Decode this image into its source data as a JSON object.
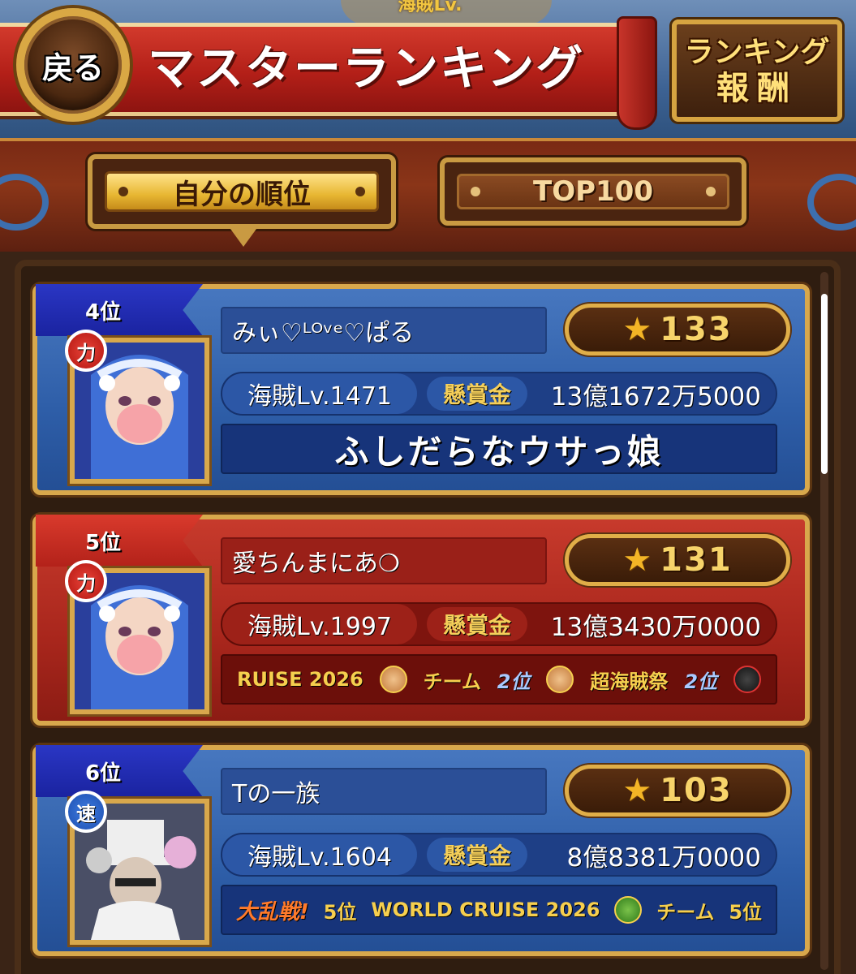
{
  "header": {
    "top_hint": "海賊Lv.",
    "back_label": "戻る",
    "title": "マスターランキング",
    "reward_line1": "ランキング",
    "reward_line2": "報酬"
  },
  "tabs": [
    {
      "label": "自分の順位",
      "active": true
    },
    {
      "label": "TOP100",
      "active": false
    }
  ],
  "rankings": [
    {
      "rank": "4位",
      "theme": "blue",
      "attribute": "力",
      "name": "みぃ♡ᴸᴼᵛᵉ♡ぱる",
      "stars": "133",
      "pirate_lv": "海賊Lv.1471",
      "bounty_label": "懸賞金",
      "bounty": "13億1672万5000",
      "title": "ふしだらなウサっ娘"
    },
    {
      "rank": "5位",
      "theme": "red",
      "attribute": "力",
      "name": "愛ちんまにあ❍",
      "stars": "131",
      "pirate_lv": "海賊Lv.1997",
      "bounty_label": "懸賞金",
      "bounty": "13億3430万0000",
      "badges": [
        "RUISE 2026",
        "チーム",
        "2位",
        "超海賊祭",
        "2位"
      ]
    },
    {
      "rank": "6位",
      "theme": "blue",
      "attribute": "速",
      "name": "Tの一族",
      "stars": "103",
      "pirate_lv": "海賊Lv.1604",
      "bounty_label": "懸賞金",
      "bounty": "8億8381万0000",
      "badges": [
        "大乱戦!",
        "5位",
        "WORLD CRUISE 2026",
        "チーム",
        "5位"
      ]
    }
  ],
  "colors": {
    "card_blue": "#2e5ea8",
    "card_red": "#a8261c",
    "gold_border": "#d8a84c",
    "star_gold": "#f3b526"
  },
  "icons": [
    "star-icon",
    "back-ship-wheel-icon"
  ]
}
